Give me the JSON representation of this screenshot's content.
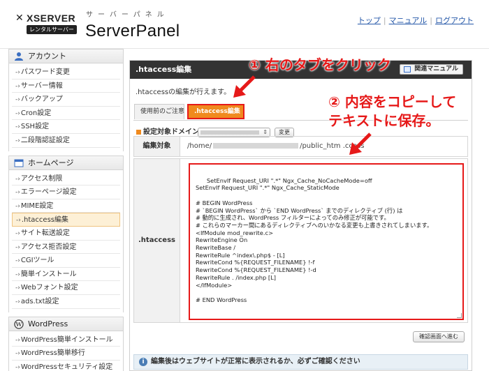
{
  "header": {
    "brand": "XSERVER",
    "brand_sub": "レンタルサーバー",
    "panel_kana": "サーバーパネル",
    "panel_title": "ServerPanel",
    "links": [
      "トップ",
      "マニュアル",
      "ログアウト"
    ]
  },
  "sidebar": {
    "sections": [
      {
        "title": "アカウント",
        "icon": "user-icon",
        "items": [
          "パスワード変更",
          "サーバー情報",
          "バックアップ",
          "Cron設定",
          "SSH設定",
          "二段階認証設定"
        ]
      },
      {
        "title": "ホームページ",
        "icon": "window-icon",
        "items": [
          "アクセス制限",
          "エラーページ設定",
          "MIME設定",
          ".htaccess編集",
          "サイト転送設定",
          "アクセス拒否設定",
          "CGIツール",
          "簡単インストール",
          "Webフォント設定",
          "ads.txt設定"
        ]
      },
      {
        "title": "WordPress",
        "icon": "wordpress-icon",
        "items": [
          "WordPress簡単インストール",
          "WordPress簡単移行",
          "WordPressセキュリティ設定"
        ]
      }
    ],
    "active_item": ".htaccess編集"
  },
  "main": {
    "title": ".htaccess編集",
    "manual_button": "関連マニュアル",
    "description": ".htaccessの編集が行えます。",
    "tabs": [
      "使用前のご注意",
      ".htaccess編集"
    ],
    "domain_label": "設定対象ドメイン",
    "change_button": "変更",
    "target_label": "編集対象",
    "target_path_prefix": "/home/",
    "target_path_suffix": "/public_htm",
    "target_path_end": ".ccess",
    "htaccess_label": ".htaccess",
    "htaccess_content": "SetEnvIf Request_URI \".*\" Ngx_Cache_NoCacheMode=off\nSetEnvIf Request_URI \".*\" Ngx_Cache_StaticMode\n\n# BEGIN WordPress\n# `BEGIN WordPress` から `END WordPress` までのディレクティブ (行) は\n# 動的に生成され、WordPress フィルターによってのみ修正が可能です。\n# これらのマーカー間にあるディレクティブへのいかなる変更も上書きされてしまいます。\n<IfModule mod_rewrite.c>\nRewriteEngine On\nRewriteBase /\nRewriteRule ^index\\.php$ - [L]\nRewriteCond %{REQUEST_FILENAME} !-f\nRewriteCond %{REQUEST_FILENAME} !-d\nRewriteRule . /index.php [L]\n</IfModule>\n\n# END WordPress",
    "confirm_button": "確認画面へ進む",
    "notice": "編集後はウェブサイトが正常に表示されるか、必ずご確認ください"
  },
  "annotations": {
    "step1": "① 右のタブをクリック",
    "step2_line1": "② 内容をコピーして",
    "step2_line2": "テキストに保存。"
  },
  "colors": {
    "accent": "#f08a1e",
    "annotation": "#e61919",
    "title_bar": "#333333"
  }
}
